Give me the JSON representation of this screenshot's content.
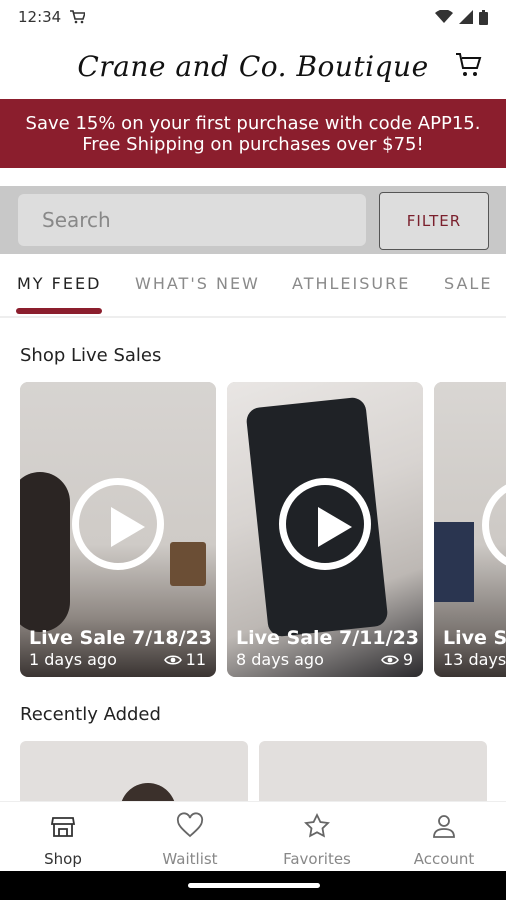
{
  "status": {
    "time": "12:34"
  },
  "header": {
    "logo_text": "Crane and Co. Boutique"
  },
  "promo": {
    "line1": "Save 15% on your first purchase with code APP15.",
    "line2": "Free Shipping on purchases over $75!"
  },
  "search": {
    "placeholder": "Search",
    "filter_label": "FILTER"
  },
  "tabs": [
    {
      "label": "MY FEED",
      "active": true
    },
    {
      "label": "WHAT'S NEW"
    },
    {
      "label": "ATHLEISURE"
    },
    {
      "label": "SALE"
    }
  ],
  "sections": {
    "live_sales_title": "Shop Live Sales",
    "recent_title": "Recently Added"
  },
  "live_sales": [
    {
      "title": "Live Sale 7/18/23",
      "age": "1 days ago",
      "views": "11"
    },
    {
      "title": "Live Sale 7/11/23",
      "age": "8 days ago",
      "views": "9"
    },
    {
      "title": "Live Sa",
      "age": "13 days",
      "views": ""
    }
  ],
  "bottom_nav": [
    {
      "label": "Shop",
      "icon": "shop-icon",
      "active": true
    },
    {
      "label": "Waitlist",
      "icon": "heart-icon"
    },
    {
      "label": "Favorites",
      "icon": "star-icon"
    },
    {
      "label": "Account",
      "icon": "person-icon"
    }
  ],
  "colors": {
    "brand": "#8b1e2d"
  }
}
